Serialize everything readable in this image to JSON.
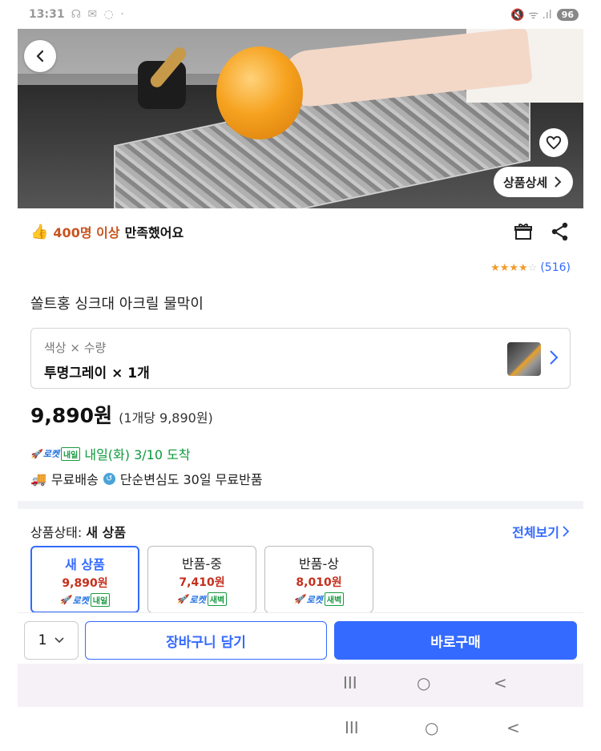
{
  "status_bar": {
    "time": "13:31",
    "left_icons": "☊ ✉ ◌ ·",
    "right_icons": "🔇 ᯤ .ıl",
    "battery": "96"
  },
  "hero": {
    "detail_label": "상품상세"
  },
  "satisfaction": {
    "count": "400명 이상",
    "text": "만족했어요"
  },
  "rating": {
    "stars": 4,
    "max": 5,
    "reviews": "(516)"
  },
  "product": {
    "title": "쏠트홍 싱크대 아크릴 물막이"
  },
  "option": {
    "label": "색상 × 수량",
    "value": "투명그레이 × 1개"
  },
  "price": {
    "main": "9,890원",
    "unit": "(1개당 9,890원)"
  },
  "delivery": {
    "rocket": "로켓",
    "tag": "내일",
    "text": "내일(화) 3/10 도착"
  },
  "shipping": {
    "free": "무료배송",
    "return": "단순변심도 30일 무료반품"
  },
  "condition": {
    "label": "상품상태: ",
    "current": "새 상품",
    "view_all": "전체보기",
    "cards": [
      {
        "name": "새 상품",
        "price": "9,890원",
        "rocket": "로켓",
        "tag": "내일"
      },
      {
        "name": "반품-중",
        "price": "7,410원",
        "rocket": "로켓",
        "tag": "새벽"
      },
      {
        "name": "반품-상",
        "price": "8,010원",
        "rocket": "로켓",
        "tag": "새벽"
      }
    ]
  },
  "bottom_bar": {
    "qty": "1",
    "cart": "장바구니 담기",
    "buy": "바로구매"
  },
  "nav": {
    "recent": "III",
    "home": "○",
    "back": "<"
  },
  "colors": {
    "accent": "#346aff",
    "price_red": "#c52e1d",
    "delivery_green": "#0c9a3b",
    "satisfaction_orange": "#c8541f"
  }
}
